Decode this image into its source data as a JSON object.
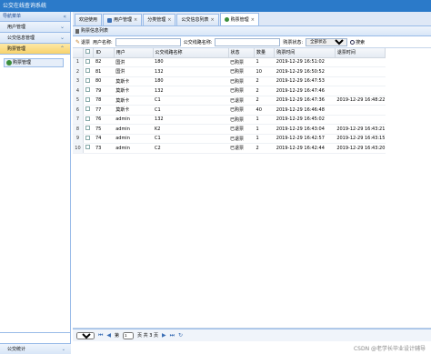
{
  "app": {
    "title": "公交在线查询系统"
  },
  "west": {
    "header": "导航菜单",
    "collapse_icon": "double-chevron-left-icon",
    "sections": [
      {
        "label": "用户管理",
        "active": false
      },
      {
        "label": "公交信息管理",
        "active": false
      },
      {
        "label": "购票管理",
        "active": true
      }
    ],
    "menu_item": "购票管理",
    "bottom_section": "公交统计"
  },
  "tabs": [
    {
      "label": "欢迎使用",
      "closable": false
    },
    {
      "label": "用户管理",
      "closable": true
    },
    {
      "label": "分类管理",
      "closable": true
    },
    {
      "label": "公交信息列表",
      "closable": true
    },
    {
      "label": "购票管理",
      "closable": true,
      "selected": true
    }
  ],
  "panel": {
    "title": "购票信息列表"
  },
  "toolbar": {
    "return_label": "退票",
    "username_label": "用户名称:",
    "username_value": "",
    "route_label": "公交线路名称:",
    "route_value": "",
    "status_label": "购票状态:",
    "status_value": "全部状态",
    "search_label": "搜索"
  },
  "grid": {
    "columns": [
      "",
      "ID",
      "用户",
      "公交线路名称",
      "状态",
      "数量",
      "购票时间",
      "退票时间"
    ],
    "rows": [
      {
        "rn": "1",
        "id": "82",
        "user": "国洪",
        "route": "180",
        "status": "已购票",
        "qty": "1",
        "buy_time": "2019-12-29 16:51:02",
        "refund_time": ""
      },
      {
        "rn": "2",
        "id": "81",
        "user": "国洪",
        "route": "132",
        "status": "已购票",
        "qty": "10",
        "buy_time": "2019-12-29 16:50:52",
        "refund_time": ""
      },
      {
        "rn": "3",
        "id": "80",
        "user": "莫斯卡",
        "route": "180",
        "status": "已购票",
        "qty": "2",
        "buy_time": "2019-12-29 16:47:53",
        "refund_time": ""
      },
      {
        "rn": "4",
        "id": "79",
        "user": "莫斯卡",
        "route": "132",
        "status": "已购票",
        "qty": "2",
        "buy_time": "2019-12-29 16:47:46",
        "refund_time": ""
      },
      {
        "rn": "5",
        "id": "78",
        "user": "莫斯卡",
        "route": "C1",
        "status": "已退票",
        "qty": "2",
        "buy_time": "2019-12-29 16:47:36",
        "refund_time": "2019-12-29 16:48:22"
      },
      {
        "rn": "6",
        "id": "77",
        "user": "莫斯卡",
        "route": "C1",
        "status": "已购票",
        "qty": "40",
        "buy_time": "2019-12-29 16:46:48",
        "refund_time": ""
      },
      {
        "rn": "7",
        "id": "76",
        "user": "admin",
        "route": "132",
        "status": "已购票",
        "qty": "1",
        "buy_time": "2019-12-29 16:45:02",
        "refund_time": ""
      },
      {
        "rn": "8",
        "id": "75",
        "user": "admin",
        "route": "K2",
        "status": "已退票",
        "qty": "1",
        "buy_time": "2019-12-29 16:43:04",
        "refund_time": "2019-12-29 16:43:21"
      },
      {
        "rn": "9",
        "id": "74",
        "user": "admin",
        "route": "C1",
        "status": "已退票",
        "qty": "1",
        "buy_time": "2019-12-29 16:42:57",
        "refund_time": "2019-12-29 16:43:15"
      },
      {
        "rn": "10",
        "id": "73",
        "user": "admin",
        "route": "C2",
        "status": "已退票",
        "qty": "2",
        "buy_time": "2019-12-29 16:42:44",
        "refund_time": "2019-12-29 16:43:20"
      }
    ]
  },
  "pager": {
    "page_size": "10",
    "page_prefix": "第",
    "page_value": "1",
    "page_suffix": "页 共 3 页",
    "first_icon": "first-page-icon",
    "prev_icon": "prev-page-icon",
    "next_icon": "next-page-icon",
    "last_icon": "last-page-icon",
    "refresh_icon": "refresh-icon"
  },
  "watermark": "CSDN @老学长毕业设计辅导",
  "colors": {
    "title_bar": "#2b7ac9",
    "border": "#99bbe8",
    "active_section": "#f8d26b"
  }
}
